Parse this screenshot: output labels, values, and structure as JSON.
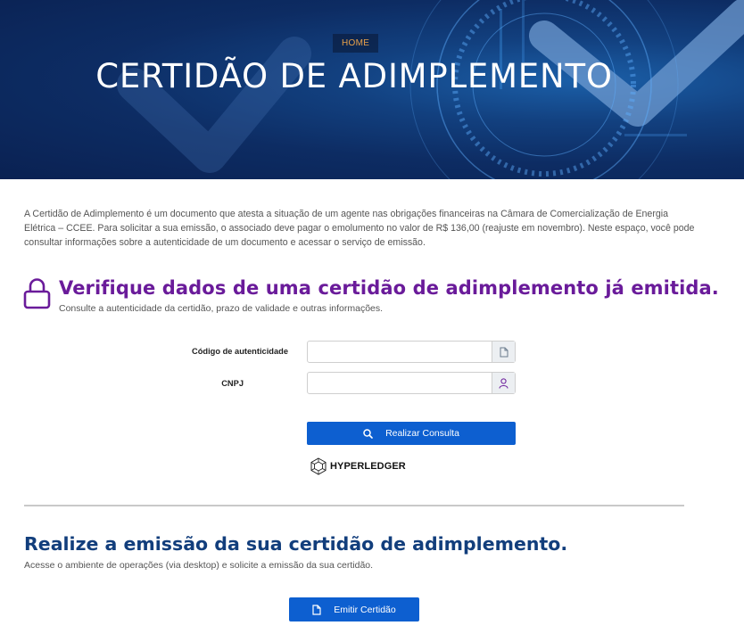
{
  "hero": {
    "breadcrumb": "HOME",
    "title": "CERTIDÃO DE ADIMPLEMENTO"
  },
  "intro": {
    "text": "A Certidão de Adimplemento é um documento que atesta a situação de um agente nas obrigações financeiras na Câmara de Comercialização de Energia Elétrica – CCEE. Para solicitar a sua emissão, o associado deve pagar o emolumento no valor de R$ 136,00 (reajuste em novembro). Neste espaço, você pode consultar informações sobre a autenticidade de um documento e acessar o serviço de emissão."
  },
  "verify": {
    "title": "Verifique dados de uma certidão de adimplemento já emitida.",
    "subtitle": "Consulte a autenticidade da certidão, prazo de validade e outras informações.",
    "auth_code_label": "Código de autenticidade",
    "auth_code_value": "",
    "cnpj_label": "CNPJ",
    "cnpj_value": "",
    "submit_label": "Realizar Consulta",
    "powered_by": "HYPERLEDGER"
  },
  "emission": {
    "title": "Realize a emissão da sua certidão de adimplemento.",
    "subtitle": "Acesse o ambiente de operações (via desktop) e solicite a emissão da sua certidão.",
    "button_label": "Emitir Certidão"
  },
  "colors": {
    "hero_bg": "#0d2c63",
    "breadcrumb_text": "#e8a14a",
    "verify_title": "#6a1b9a",
    "emission_title": "#123e7c",
    "primary_button": "#0d5fd0"
  },
  "icons": {
    "lock": "lock-icon",
    "document": "document-icon",
    "user": "user-icon",
    "search": "search-icon",
    "hyperledger": "hyperledger-logo-icon",
    "file": "file-icon"
  }
}
